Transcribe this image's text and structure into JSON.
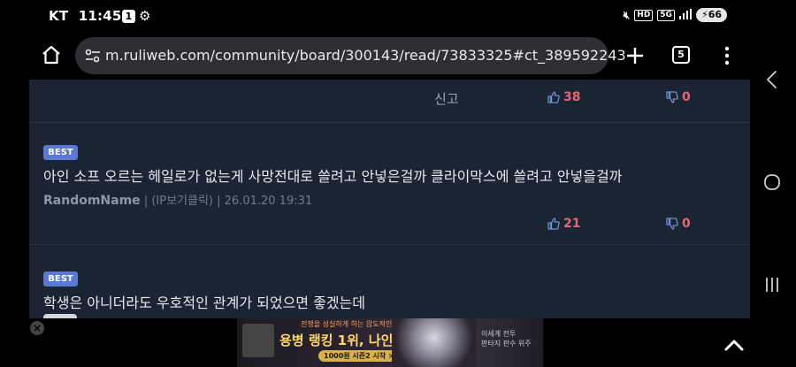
{
  "status_bar": {
    "carrier": "KT",
    "time": "11:45",
    "notification_count": "1",
    "network": "5G",
    "hd_label": "HD",
    "battery": "66"
  },
  "browser": {
    "url": "m.ruliweb.com/community/board/300143/read/73833325#ct_389592243",
    "tab_count": "5"
  },
  "comments": {
    "previous": {
      "report_label": "신고",
      "upvotes": "38",
      "downvotes": "0"
    },
    "items": [
      {
        "badge": "BEST",
        "text": "아인 소프 오르는 헤일로가 없는게 사망전대로 쓸려고 안넣은걸까 클라이막스에 쓸려고 안넣을걸까",
        "author": "RandomName",
        "ip_label": "(IP보기클릭)",
        "date": "26.01.20 19:31",
        "upvotes": "21",
        "downvotes": "0"
      },
      {
        "badge": "BEST",
        "text": "학생은 아니더라도 우호적인 관계가 되었으면 좋겠는데"
      }
    ]
  },
  "ad": {
    "close": "×",
    "tagline": "전쟁을 성실하게 하는 압도적인 힘",
    "headline": "용병 랭킹 1위, 나인",
    "cta": "1000원 시즌2 시작 >",
    "side_text_1": "이세계 전투",
    "side_text_2": "판타지 판수 위주"
  },
  "colors": {
    "page_bg": "#1a2433",
    "badge_bg": "#5a78d6",
    "vote_red": "#e06a73",
    "url_bar_bg": "#2d2f33"
  },
  "icons": {
    "home": "home-icon",
    "site_settings": "tune-icon",
    "new_tab": "plus-icon",
    "menu": "more-vert-icon",
    "upvote": "thumb-up-icon",
    "downvote": "thumb-down-icon",
    "scroll_top": "chevron-up-icon",
    "nav_back": "chevron-left-icon",
    "nav_home": "circle-icon",
    "nav_recent": "recent-apps-icon"
  }
}
